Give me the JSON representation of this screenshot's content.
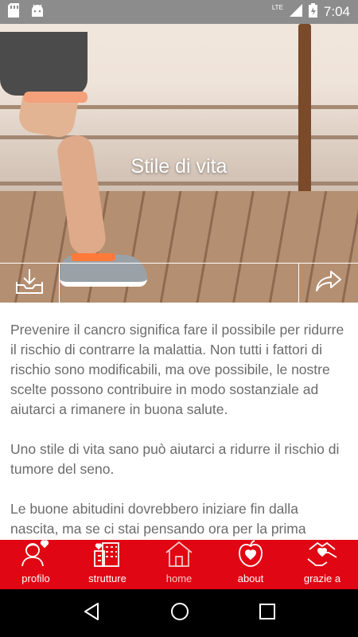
{
  "status_bar": {
    "network": "LTE",
    "time": "7:04",
    "icons": [
      "sd-card-icon",
      "android-icon",
      "signal-icon",
      "battery-icon"
    ]
  },
  "hero": {
    "title": "Stile di vita"
  },
  "actions": {
    "left_icon": "download-icon",
    "right_icon": "share-icon"
  },
  "content": {
    "paragraphs": [
      "Prevenire il cancro significa fare il possibile per ridurre il rischio di contrarre la malattia. Non tutti i fattori di rischio sono modificabili, ma ove possibile, le nostre scelte possono contribuire in modo sostanziale ad aiutarci a rimanere in buona salute.",
      "Uno stile di vita sano può aiutarci a ridurre il rischio di tumore del seno.",
      "Le buone abitudini dovrebbero iniziare fin dalla nascita, ma se ci stai pensando ora per la prima"
    ]
  },
  "tabs": [
    {
      "label": "profilo",
      "icon": "profile-heart-icon",
      "active": false
    },
    {
      "label": "strutture",
      "icon": "buildings-icon",
      "active": false
    },
    {
      "label": "home",
      "icon": "home-icon",
      "active": true
    },
    {
      "label": "about",
      "icon": "apple-heart-icon",
      "active": false
    },
    {
      "label": "grazie a",
      "icon": "hands-heart-icon",
      "active": false
    }
  ],
  "colors": {
    "accent": "#e10613",
    "text": "#6b6b6b",
    "status_bar": "#8c8c8c"
  },
  "nav": {
    "icons": [
      "back-icon",
      "home-circle-icon",
      "recents-icon"
    ]
  }
}
